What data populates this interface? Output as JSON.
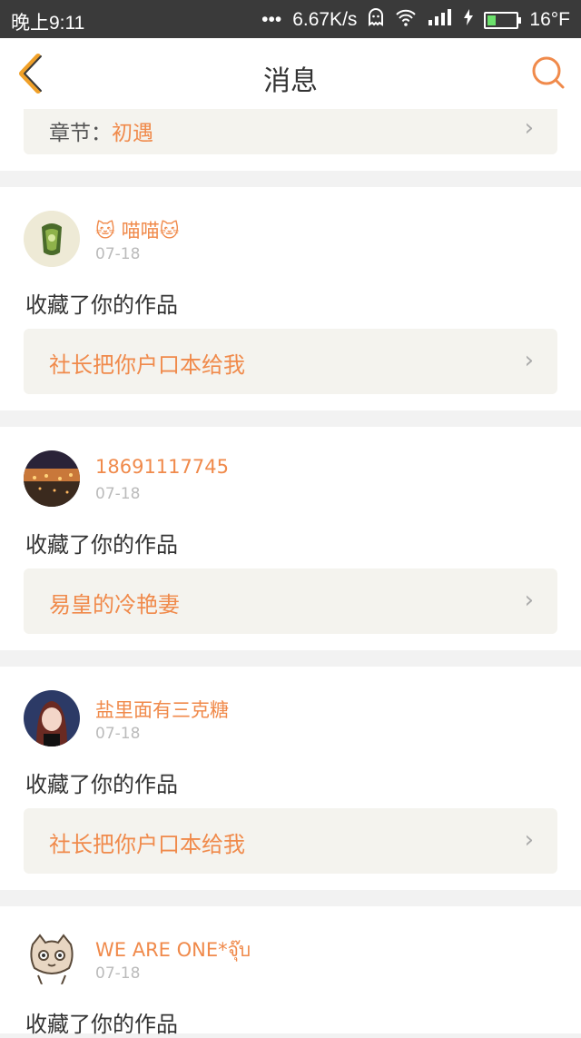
{
  "status_bar": {
    "time": "晚上9:11",
    "dots": "•••",
    "speed": "6.67K/s",
    "temperature": "16°F",
    "icons": [
      "ghost-icon",
      "wifi-icon",
      "signal-icon",
      "charging-icon",
      "battery-icon"
    ]
  },
  "nav": {
    "title": "消息",
    "back_icon": "chevron-left-icon",
    "search_icon": "search-icon"
  },
  "top_card": {
    "chapter_prefix": "章节：",
    "chapter_name": "初遇"
  },
  "messages": [
    {
      "username": "🐱 喵喵🐱",
      "date": "07-18",
      "action": "收藏了你的作品",
      "work": "社长把你户口本给我",
      "avatar": "plant-avatar"
    },
    {
      "username": "18691117745",
      "date": "07-18",
      "action": "收藏了你的作品",
      "work": "易皇的冷艳妻",
      "avatar": "city-night-avatar"
    },
    {
      "username": "盐里面有三克糖",
      "date": "07-18",
      "action": "收藏了你的作品",
      "work": "社长把你户口本给我",
      "avatar": "girl-avatar"
    },
    {
      "username": "WE ARE ONE*จุ๊บ",
      "date": "07-18",
      "action": "收藏了你的作品",
      "avatar": "cat-avatar"
    }
  ],
  "chevron": "›",
  "colors": {
    "accent": "#f08a4b",
    "status_bar": "#3a3a3a",
    "work_bg": "#f4f3ee"
  }
}
